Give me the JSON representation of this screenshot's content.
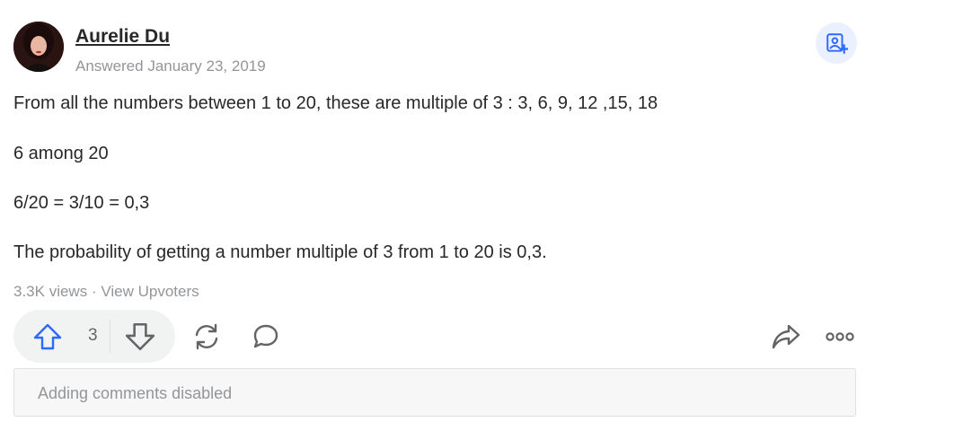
{
  "author": {
    "name": "Aurelie Du",
    "answered_date": "Answered January 23, 2019"
  },
  "answer": {
    "paragraphs": [
      "From all the numbers between 1 to 20, these are multiple of 3 : 3, 6, 9, 12 ,15, 18",
      "6 among 20",
      "6/20 = 3/10 = 0,3",
      "The probability of getting a number multiple of 3 from 1 to 20 is 0,3."
    ]
  },
  "meta": {
    "views": "3.3K views",
    "separator": "·",
    "upvoters_link": "View Upvoters"
  },
  "actions": {
    "upvote_count": "3",
    "icons": {
      "follow": "person-plus-icon",
      "upvote": "arrow-up-icon",
      "downvote": "arrow-down-icon",
      "reshare": "refresh-icon",
      "comment": "comment-bubble-icon",
      "share": "share-arrow-icon",
      "more": "more-dots-icon"
    }
  },
  "comments": {
    "disabled_text": "Adding comments disabled"
  },
  "colors": {
    "accent": "#2e69ff",
    "text": "#282829",
    "muted": "#939598",
    "pill_bg": "#f1f2f2",
    "follow_bg": "#ebf0ff"
  }
}
